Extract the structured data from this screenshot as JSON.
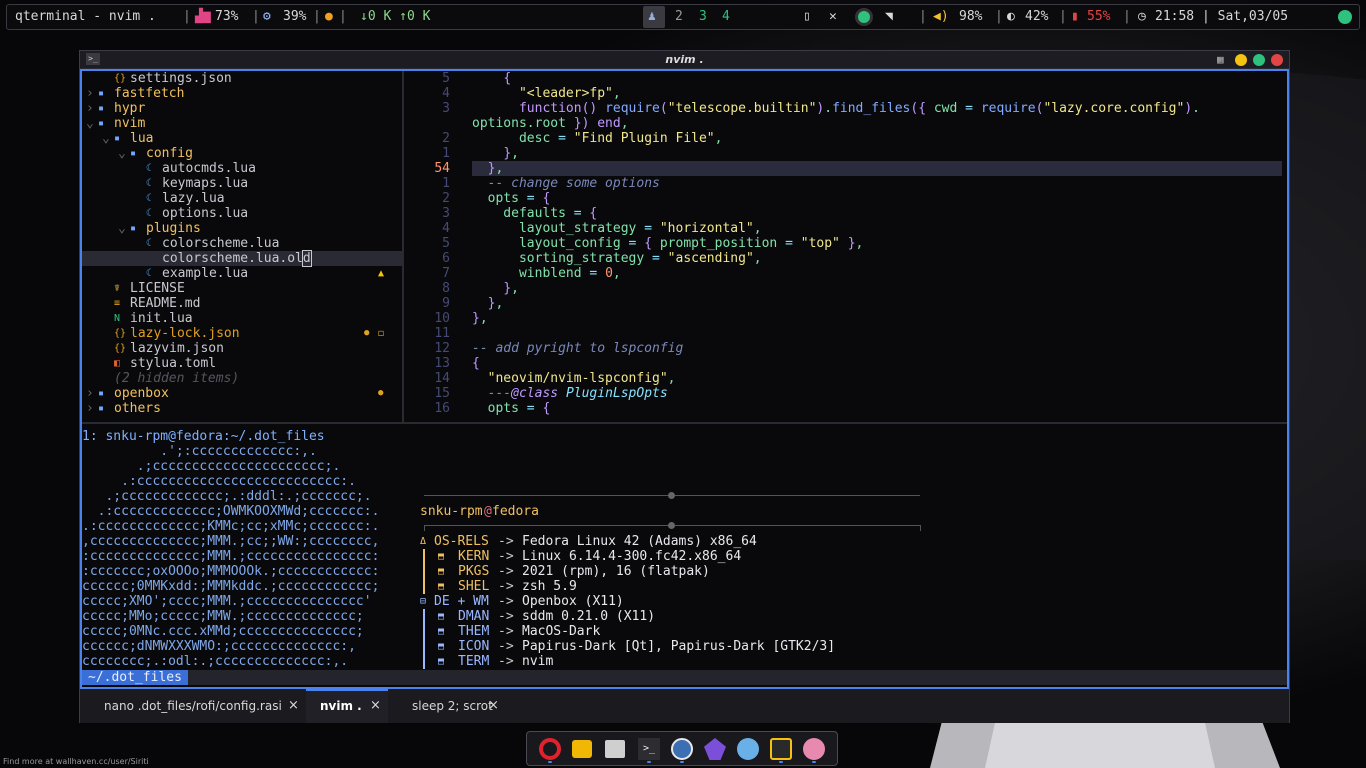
{
  "topbar": {
    "window_title": "qterminal - nvim .",
    "cpu": "73%",
    "memory": "39%",
    "net": "↓0 K ↑0 K",
    "workspaces": [
      "2",
      "3",
      "4"
    ],
    "volume": "98%",
    "brightness": "42%",
    "battery": "55%",
    "clock": "21:58 | Sat,03/05"
  },
  "window": {
    "title": "nvim ."
  },
  "explorer": {
    "rows": [
      {
        "text": "settings.json",
        "icon": "{}"
      },
      {
        "text": "fastfetch"
      },
      {
        "text": "hypr"
      },
      {
        "text": "nvim"
      },
      {
        "text": "lua"
      },
      {
        "text": "config"
      },
      {
        "text": "autocmds.lua"
      },
      {
        "text": "keymaps.lua"
      },
      {
        "text": "lazy.lua"
      },
      {
        "text": "options.lua"
      },
      {
        "text": "plugins"
      },
      {
        "text": "colorscheme.lua"
      },
      {
        "text": "colorscheme.lua.old"
      },
      {
        "text": "example.lua"
      },
      {
        "text": "LICENSE"
      },
      {
        "text": "README.md"
      },
      {
        "text": "init.lua"
      },
      {
        "text": "lazy-lock.json"
      },
      {
        "text": "lazyvim.json"
      },
      {
        "text": "stylua.toml"
      },
      {
        "text": "(2 hidden items)"
      },
      {
        "text": "openbox"
      },
      {
        "text": "others"
      }
    ]
  },
  "editor": {
    "lines": [
      {
        "num": "5",
        "text": "    {"
      },
      {
        "num": "4",
        "text": "      \"<leader>fp\","
      },
      {
        "num": "3",
        "text": "      function() require(\"telescope.builtin\").find_files({ cwd = require(\"lazy.core.config\")."
      },
      {
        "num": "",
        "text": "options.root }) end,"
      },
      {
        "num": "2",
        "text": "      desc = \"Find Plugin File\","
      },
      {
        "num": "1",
        "text": "    },"
      },
      {
        "num": "54",
        "text": "  },"
      },
      {
        "num": "1",
        "text": "  -- change some options"
      },
      {
        "num": "2",
        "text": "  opts = {"
      },
      {
        "num": "3",
        "text": "    defaults = {"
      },
      {
        "num": "4",
        "text": "      layout_strategy = \"horizontal\","
      },
      {
        "num": "5",
        "text": "      layout_config = { prompt_position = \"top\" },"
      },
      {
        "num": "6",
        "text": "      sorting_strategy = \"ascending\","
      },
      {
        "num": "7",
        "text": "      winblend = 0,"
      },
      {
        "num": "8",
        "text": "    },"
      },
      {
        "num": "9",
        "text": "  },"
      },
      {
        "num": "10",
        "text": "},"
      },
      {
        "num": "11",
        "text": ""
      },
      {
        "num": "12",
        "text": "-- add pyright to lspconfig"
      },
      {
        "num": "13",
        "text": "{"
      },
      {
        "num": "14",
        "text": "  \"neovim/nvim-lspconfig\","
      },
      {
        "num": "15",
        "text": "  ---@class PluginLspOpts"
      },
      {
        "num": "16",
        "text": "  opts = {"
      }
    ]
  },
  "terminal": {
    "prompt": "1: snku-rpm@fedora:~/.dot_files",
    "ascii": [
      "          .';:ccccccccccccc:,.",
      "       .;cccccccccccccccccccccc;.",
      "     .:cccccccccccccccccccccccccc:.",
      "   .;ccccccccccccc;.:dddl:.;ccccccc;.",
      "  .:ccccccccccccc;OWMKOOXMWd;ccccccc:.",
      ".:ccccccccccccc;KMMc;cc;xMMc;ccccccc:.",
      ",cccccccccccccc;MMM.;cc;;WW:;cccccccc,",
      ":cccccccccccccc;MMM.;cccccccccccccccc:",
      ":ccccccc;oxOOOo;MMMOOOk.;cccccccccccc:",
      "cccccc;0MMKxdd:;MMMkddc.;cccccccccccc;",
      "ccccc;XMO';cccc;MMM.;ccccccccccccccc'",
      "ccccc;MMo;ccccc;MMW.;cccccccccccccc;",
      "ccccc;0MNc.ccc.xMMd;ccccccccccccccc;",
      "cccccc;dNMWXXXWMO:;cccccccccccccc:,",
      "cccccccc;.:odl:.;cccccccccccccc:,."
    ],
    "fetch_user": "snku-rpm",
    "fetch_host": "fedora",
    "fetch_rows": [
      {
        "key": "OS-RELS",
        "value": "Fedora Linux 42 (Adams) x86_64"
      },
      {
        "key": "KERN",
        "value": "Linux 6.14.4-300.fc42.x86_64"
      },
      {
        "key": "PKGS",
        "value": "2021 (rpm), 16 (flatpak)"
      },
      {
        "key": "SHEL",
        "value": "zsh 5.9"
      },
      {
        "key": "DE + WM",
        "value": "Openbox (X11)"
      },
      {
        "key": "DMAN",
        "value": "sddm 0.21.0 (X11)"
      },
      {
        "key": "THEM",
        "value": "MacOS-Dark"
      },
      {
        "key": "ICON",
        "value": "Papirus-Dark [Qt], Papirus-Dark [GTK2/3]"
      },
      {
        "key": "TERM",
        "value": "nvim"
      }
    ],
    "arrow": "->",
    "statusline": "~/.dot_files"
  },
  "tabs": [
    {
      "label": "nano .dot_files/rofi/config.rasi",
      "close": "×"
    },
    {
      "label": "nvim .",
      "close": "×"
    },
    {
      "label": "sleep 2; scrot",
      "close": "×"
    }
  ],
  "dock": {
    "apps": [
      "opera-icon",
      "files-icon",
      "archive-icon",
      "terminal-icon",
      "fedora-icon",
      "obsidian-icon",
      "settings-icon",
      "music-icon",
      "media-icon"
    ]
  },
  "credit": "Find more at wallhaven.cc/user/Siriti",
  "colors": {
    "accent": "#4a82ee",
    "green": "#2ec27e",
    "red": "#e24545"
  }
}
